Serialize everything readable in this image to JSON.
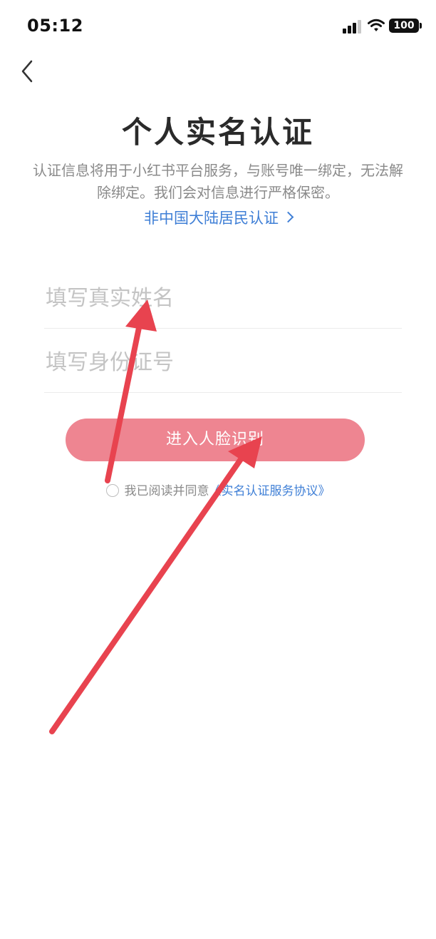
{
  "status_bar": {
    "time": "05:12",
    "battery": "100"
  },
  "header": {
    "back_icon": "chevron-left-icon"
  },
  "title": "个人实名认证",
  "description": "认证信息将用于小红书平台服务，与账号唯一绑定，无法解除绑定。我们会对信息进行严格保密。",
  "nonmainland_link": "非中国大陆居民认证",
  "form": {
    "name_placeholder": "填写真实姓名",
    "id_placeholder": "填写身份证号"
  },
  "submit_button": "进入人脸识别",
  "agreement": {
    "prefix": "我已阅读并同意",
    "link": "《实名认证服务协议》"
  },
  "colors": {
    "accent_link": "#3f7fd6",
    "button": "#ee8591",
    "annotation_arrow": "#e8434f"
  }
}
